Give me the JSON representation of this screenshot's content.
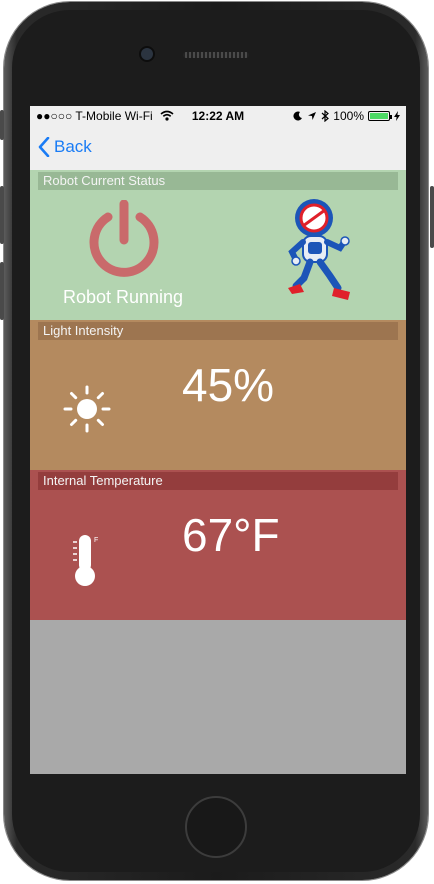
{
  "status_bar": {
    "carrier": "●●○○○ T-Mobile Wi-Fi",
    "time": "12:22 AM",
    "battery": "100%",
    "battery_color": "#4cd964"
  },
  "nav": {
    "back_label": "Back",
    "back_icon": "chevron-left-icon",
    "accent": "#1a7cf5"
  },
  "panels": {
    "robot_status": {
      "header": "Robot Current Status",
      "status_text": "Robot Running",
      "icon": "power-icon",
      "image": "running-robot-icon",
      "bg": "#b3d4b0"
    },
    "light": {
      "header": "Light Intensity",
      "value": "45%",
      "icon": "sun-icon",
      "bg": "#b48a5f"
    },
    "temperature": {
      "header": "Internal Temperature",
      "value": "67°F",
      "icon": "thermometer-icon",
      "bg": "#ab5150"
    }
  }
}
